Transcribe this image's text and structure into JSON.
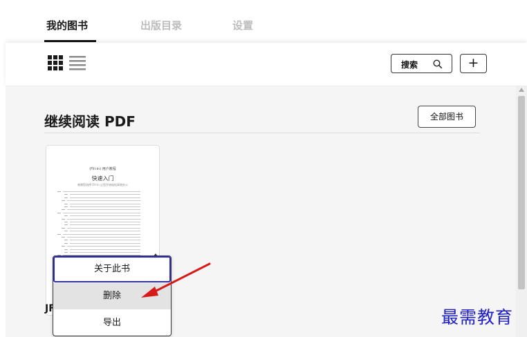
{
  "tabs": {
    "my_books": "我的图书",
    "catalog": "出版目录",
    "settings": "设置"
  },
  "toolbar": {
    "search_label": "搜索",
    "add_label": "+"
  },
  "section": {
    "title": "继续阅读 PDF",
    "all_books": "全部图书"
  },
  "book": {
    "thumb_title": "(Fill-in)  用户教程",
    "thumb_heading": "快速入门",
    "thumb_subtitle": "感谢您选择 Fill-in 让您开始轻松高效办公",
    "author_prefix": "JF"
  },
  "context_menu": {
    "about": "关于此书",
    "delete": "删除",
    "export": "导出"
  },
  "watermark": "最需教育",
  "colors": {
    "menu_highlight_border": "#2b2bc9",
    "annotation_arrow": "#d61a1a",
    "watermark": "#2020c8"
  }
}
